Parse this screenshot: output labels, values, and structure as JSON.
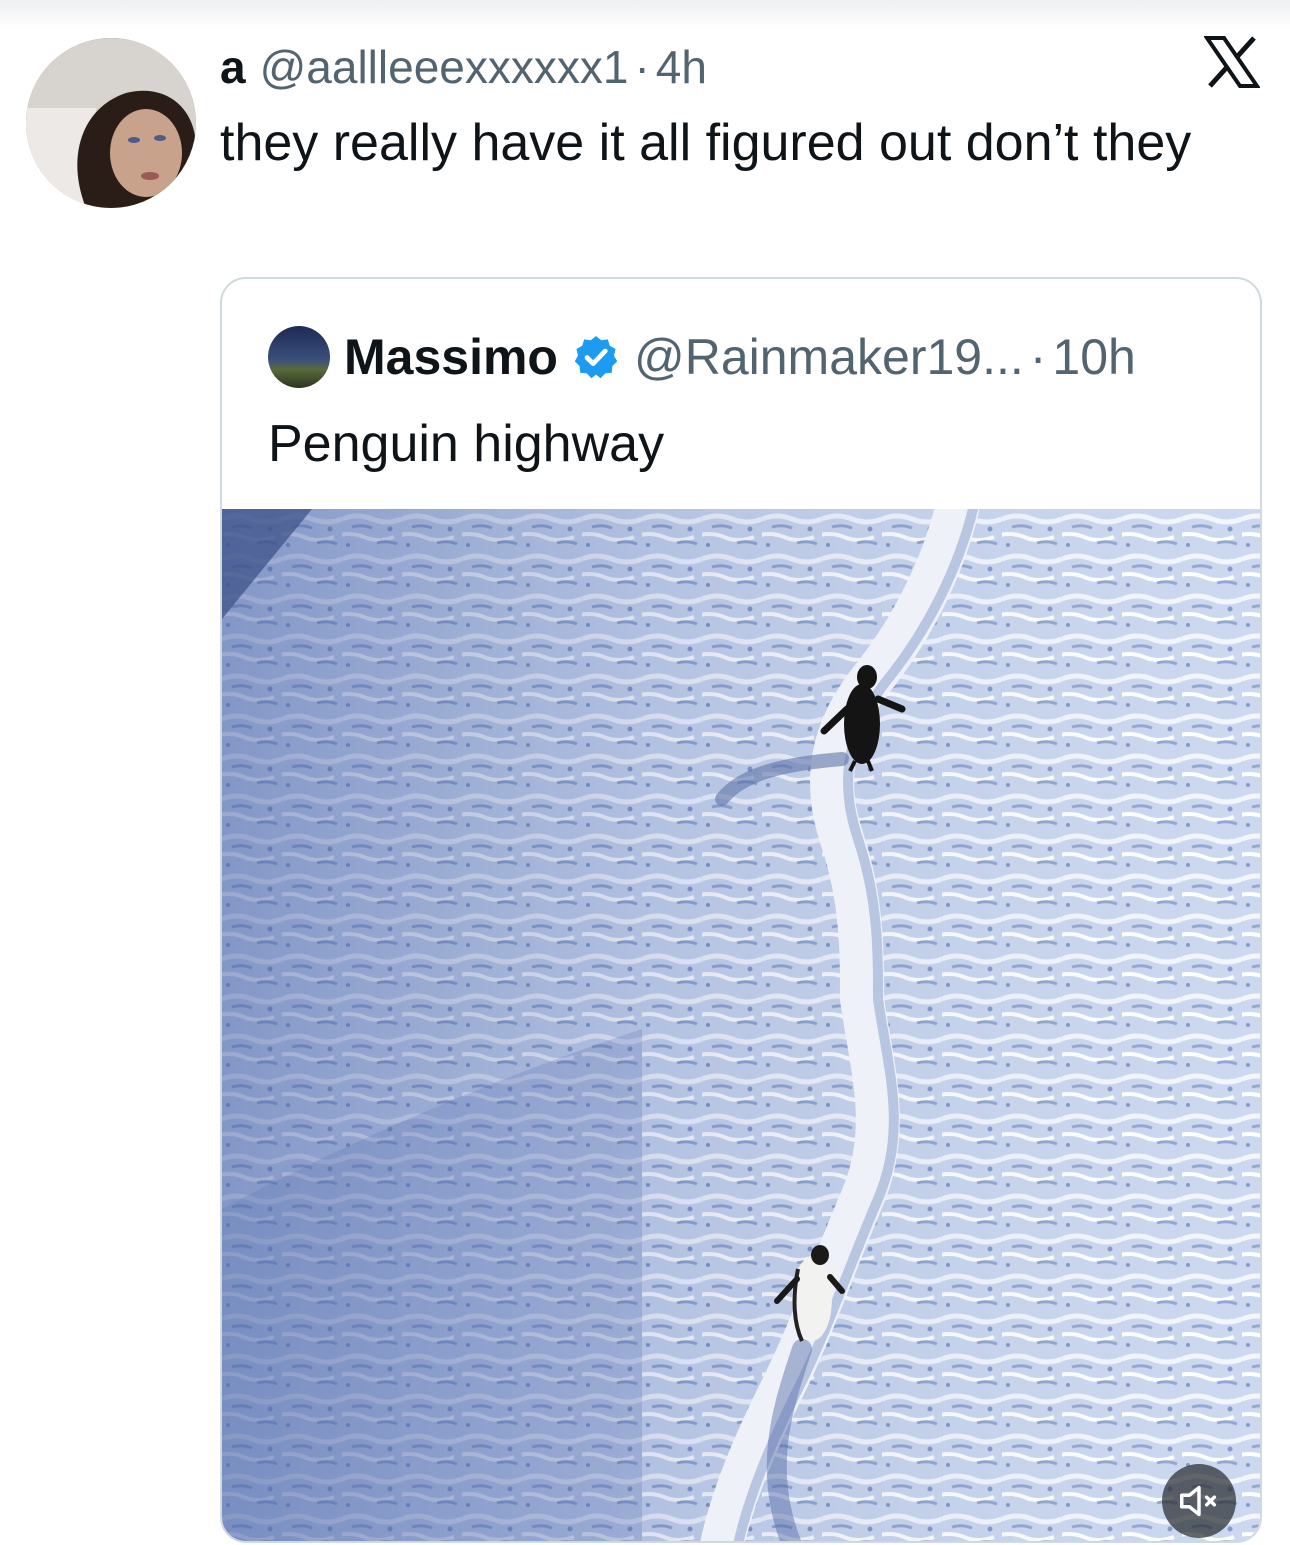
{
  "tweet": {
    "author_name": "a",
    "author_handle": "@aallleeexxxxxx1",
    "separator": "·",
    "time": "4h",
    "text": "they really have it all figured out don’t they"
  },
  "quoted_tweet": {
    "author_name": "Massimo",
    "author_handle": "@Rainmaker19...",
    "separator": "·",
    "time": "10h",
    "text": "Penguin highway",
    "verified": true
  },
  "icons": {
    "platform_logo": "x-logo-icon",
    "verified_badge": "verified-badge-icon",
    "mute": "speaker-muted-icon"
  },
  "colors": {
    "text_primary": "#0f1419",
    "text_secondary": "#536471",
    "verified_blue": "#1d9bf0",
    "border": "#cfd9de"
  }
}
